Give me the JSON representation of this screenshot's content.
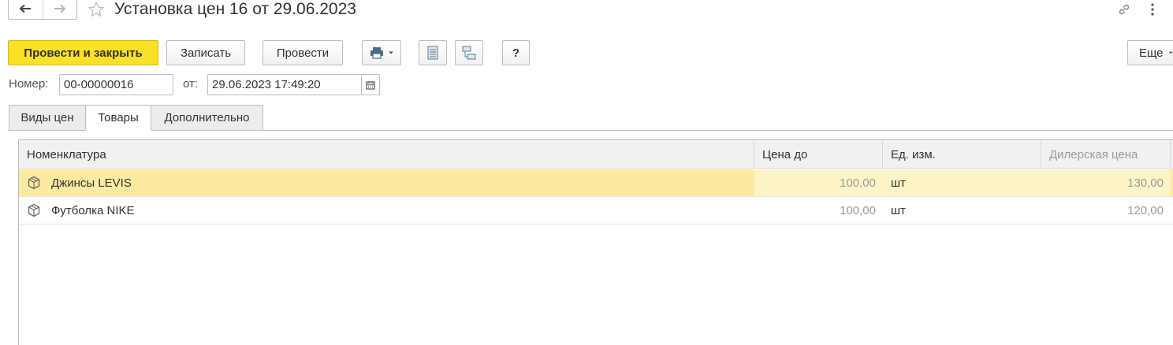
{
  "window": {
    "title": "Установка цен 16 от 29.06.2023",
    "back_icon": "arrow-left-icon",
    "forward_icon": "arrow-right-icon",
    "favorite_icon": "star-icon",
    "link_icon": "link-icon",
    "menu_icon": "vertical-dots-icon"
  },
  "toolbar": {
    "post_and_close_label": "Провести и закрыть",
    "save_label": "Записать",
    "post_label": "Провести",
    "print_icon": "printer-icon",
    "list_icon": "list-icon",
    "structure_icon": "structure-icon",
    "help_label": "?",
    "more_label": "Еще"
  },
  "header_fields": {
    "number_label": "Номер:",
    "number_value": "00-00000016",
    "date_label": "от:",
    "date_value": "29.06.2023 17:49:20",
    "calendar_icon": "calendar-icon"
  },
  "tabs": [
    {
      "label": "Виды цен",
      "active": false
    },
    {
      "label": "Товары",
      "active": true
    },
    {
      "label": "Дополнительно",
      "active": false
    }
  ],
  "table": {
    "columns": [
      "Номенклатура",
      "Цена до",
      "Ед. изм.",
      "Дилерская цена"
    ],
    "rows": [
      {
        "name": "Джинсы LEVIS",
        "price_before": "100,00",
        "unit": "шт",
        "dealer_price": "130,00",
        "selected": true
      },
      {
        "name": "Футболка NIKE",
        "price_before": "100,00",
        "unit": "шт",
        "dealer_price": "120,00",
        "selected": false
      }
    ]
  },
  "colors": {
    "primary_button": "#fbe02a",
    "selected_row": "#fbeaa0",
    "muted_text": "#9a9a9a"
  }
}
